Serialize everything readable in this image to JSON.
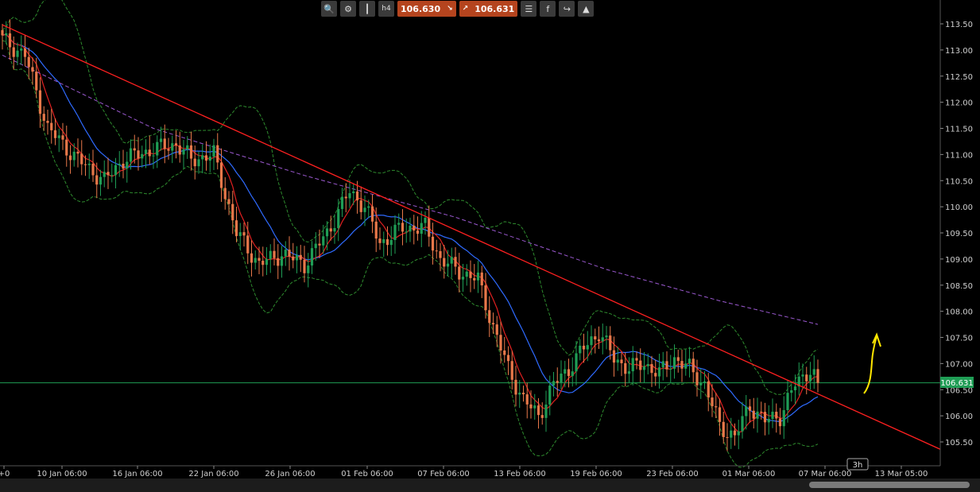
{
  "toolbar": {
    "bid_price": "106.630",
    "ask_price": "106.631",
    "timeframe": "h4",
    "icons": [
      "zoom-icon",
      "indicator-settings-icon",
      "chart-type-icon",
      "timeframe-icon",
      "list-icon",
      "facebook-icon",
      "share-icon",
      "trader-icon"
    ]
  },
  "chart_data": {
    "type": "candlestick",
    "y_axis": {
      "range": [
        105.2,
        113.9
      ],
      "ticks": [
        "113.50",
        "113.00",
        "112.50",
        "112.00",
        "111.50",
        "111.00",
        "110.50",
        "110.00",
        "109.50",
        "109.00",
        "108.50",
        "108.00",
        "107.50",
        "107.00",
        "106.50",
        "106.00",
        "105.50"
      ]
    },
    "x_axis": {
      "ticks": [
        "+0",
        "10 Jan 06:00",
        "16 Jan 06:00",
        "22 Jan 06:00",
        "26 Jan 06:00",
        "01 Feb 06:00",
        "07 Feb 06:00",
        "13 Feb 06:00",
        "19 Feb 06:00",
        "23 Feb 06:00",
        "01 Mar 06:00",
        "07 Mar 06:00",
        "13 Mar 05:00"
      ]
    },
    "current_price": "106.631",
    "time_badge": "3h",
    "colors": {
      "bull": "#1f9d55",
      "bear": "#e8784a",
      "ma_fast": "#e02020",
      "ma_slow": "#2f6bff",
      "ma_long": "#9b59d0",
      "bands": "#2e8b2e",
      "trendline": "#ff2020",
      "price_line": "#1f9d55",
      "arrow": "#ffe600"
    },
    "close_keypoints": [
      [
        0,
        113.2
      ],
      [
        6,
        112.9
      ],
      [
        12,
        111.5
      ],
      [
        20,
        110.9
      ],
      [
        27,
        110.5
      ],
      [
        32,
        110.9
      ],
      [
        40,
        111.1
      ],
      [
        46,
        111.2
      ],
      [
        50,
        110.9
      ],
      [
        56,
        111.0
      ],
      [
        62,
        109.5
      ],
      [
        68,
        108.9
      ],
      [
        74,
        109.1
      ],
      [
        80,
        108.9
      ],
      [
        86,
        109.5
      ],
      [
        92,
        110.3
      ],
      [
        96,
        110.0
      ],
      [
        100,
        109.3
      ],
      [
        106,
        109.6
      ],
      [
        112,
        109.6
      ],
      [
        116,
        109.0
      ],
      [
        120,
        108.8
      ],
      [
        126,
        108.6
      ],
      [
        130,
        107.7
      ],
      [
        134,
        106.9
      ],
      [
        138,
        106.3
      ],
      [
        142,
        106.0
      ],
      [
        146,
        106.6
      ],
      [
        150,
        106.9
      ],
      [
        154,
        107.3
      ],
      [
        158,
        107.6
      ],
      [
        162,
        107.1
      ],
      [
        166,
        106.9
      ],
      [
        170,
        107.0
      ],
      [
        174,
        106.8
      ],
      [
        178,
        107.1
      ],
      [
        182,
        106.9
      ],
      [
        186,
        106.6
      ],
      [
        190,
        105.8
      ],
      [
        194,
        105.6
      ],
      [
        198,
        106.2
      ],
      [
        202,
        105.9
      ],
      [
        206,
        106.0
      ],
      [
        210,
        106.6
      ],
      [
        214,
        106.9
      ],
      [
        216,
        106.63
      ]
    ],
    "trendline": {
      "start": [
        0,
        113.48
      ],
      "end": [
        238,
        105.7
      ]
    },
    "ma_long_keypoints": [
      [
        0,
        112.9
      ],
      [
        40,
        111.5
      ],
      [
        80,
        110.6
      ],
      [
        120,
        109.8
      ],
      [
        160,
        108.8
      ],
      [
        190,
        108.2
      ],
      [
        216,
        107.75
      ]
    ]
  }
}
